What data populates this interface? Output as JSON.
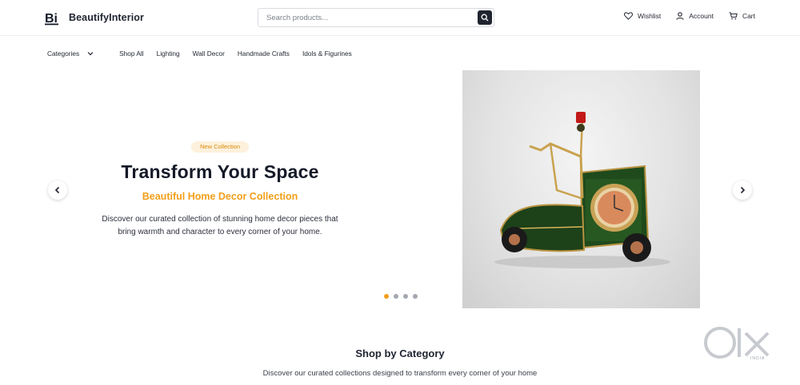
{
  "brand": {
    "name": "BeautifyInterior",
    "logo_letters": "Bi"
  },
  "search": {
    "placeholder": "Search products...",
    "value": ""
  },
  "header_actions": [
    {
      "label": "Wishlist",
      "icon": "heart-icon"
    },
    {
      "label": "Account",
      "icon": "user-icon"
    },
    {
      "label": "Cart",
      "icon": "cart-icon"
    }
  ],
  "nav": {
    "categories_label": "Categories",
    "items": [
      "Shop All",
      "Lighting",
      "Wall Decor",
      "Handmade Crafts",
      "Idols & Figurines"
    ]
  },
  "hero": {
    "badge": "New Collection",
    "title": "Transform Your Space",
    "subtitle": "Beautiful Home Decor Collection",
    "description": "Discover our curated collection of stunning home decor pieces that bring warmth and character to every corner of your home.",
    "slide_count": 4,
    "active_slide": 1,
    "image_subject": "scooter-clock-figurine"
  },
  "category_section": {
    "title": "Shop by Category",
    "description": "Discover our curated collections designed to transform every corner of your home"
  },
  "watermark": {
    "logo": "olx-logo",
    "sub": "INDIA"
  },
  "colors": {
    "accent": "#f29f1a",
    "dark": "#1f2430",
    "badge_bg": "#fdf1dc"
  }
}
